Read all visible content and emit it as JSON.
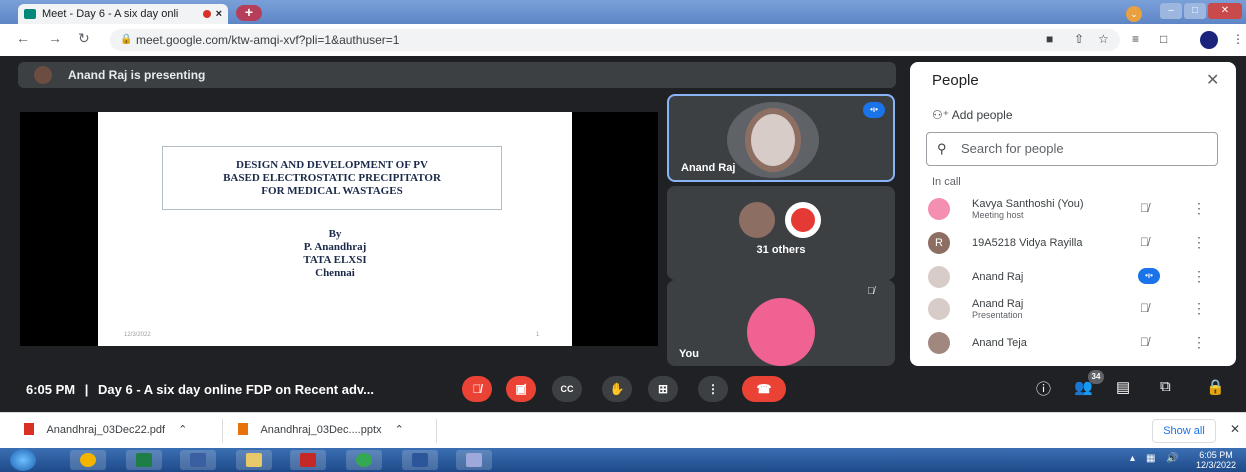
{
  "browser": {
    "tab_title": "Meet - Day 6 - A six day onli",
    "tab_close": "×",
    "new_tab": "+",
    "url": "meet.google.com/ktw-amqi-xvf?pli=1&authuser=1"
  },
  "meet": {
    "presenting_text": "Anand Raj is presenting",
    "slide": {
      "title_lines": [
        "DESIGN AND DEVELOPMENT OF PV",
        "BASED ELECTROSTATIC PRECIPITATOR",
        "FOR MEDICAL WASTAGES"
      ],
      "by_lines": [
        "By",
        "P. Anandhraj",
        "TATA ELXSI",
        "Chennai"
      ],
      "date": "12/3/2022",
      "number": "1"
    },
    "tiles": {
      "main_name": "Anand Raj",
      "others_label": "31 others",
      "you_label": "You"
    }
  },
  "people": {
    "title": "People",
    "add_people": "Add people",
    "search_placeholder": "Search for people",
    "in_call": "In call",
    "participants": [
      {
        "name": "Kavya Santhoshi (You)",
        "sub": "Meeting host",
        "mic": "muted",
        "avatar_color": "#f48fb1"
      },
      {
        "name": "19A5218 Vidya Rayilla",
        "sub": "",
        "mic": "muted",
        "avatar_color": "#8d6e63",
        "initial": "R"
      },
      {
        "name": "Anand Raj",
        "sub": "",
        "mic": "speaking",
        "avatar_color": "#d7ccc8"
      },
      {
        "name": "Anand Raj",
        "sub": "Presentation",
        "mic": "muted",
        "avatar_color": "#d7ccc8"
      },
      {
        "name": "Anand Teja",
        "sub": "",
        "mic": "muted",
        "avatar_color": "#a1887f"
      }
    ]
  },
  "controls": {
    "time": "6:05 PM",
    "separator": "|",
    "meeting_title": "Day 6 - A six day online FDP on Recent adv...",
    "participant_count": "34"
  },
  "downloads": {
    "items": [
      "Anandhraj_03Dec22.pdf",
      "Anandhraj_03Dec....pptx"
    ],
    "show_all": "Show all"
  },
  "taskbar": {
    "clock_time": "6:05 PM",
    "clock_date": "12/3/2022"
  },
  "colors": {
    "meet_bg": "#202124",
    "tile_bg": "#3c4043",
    "mic_red": "#ea4335",
    "speaking_blue": "#1a73e8"
  }
}
